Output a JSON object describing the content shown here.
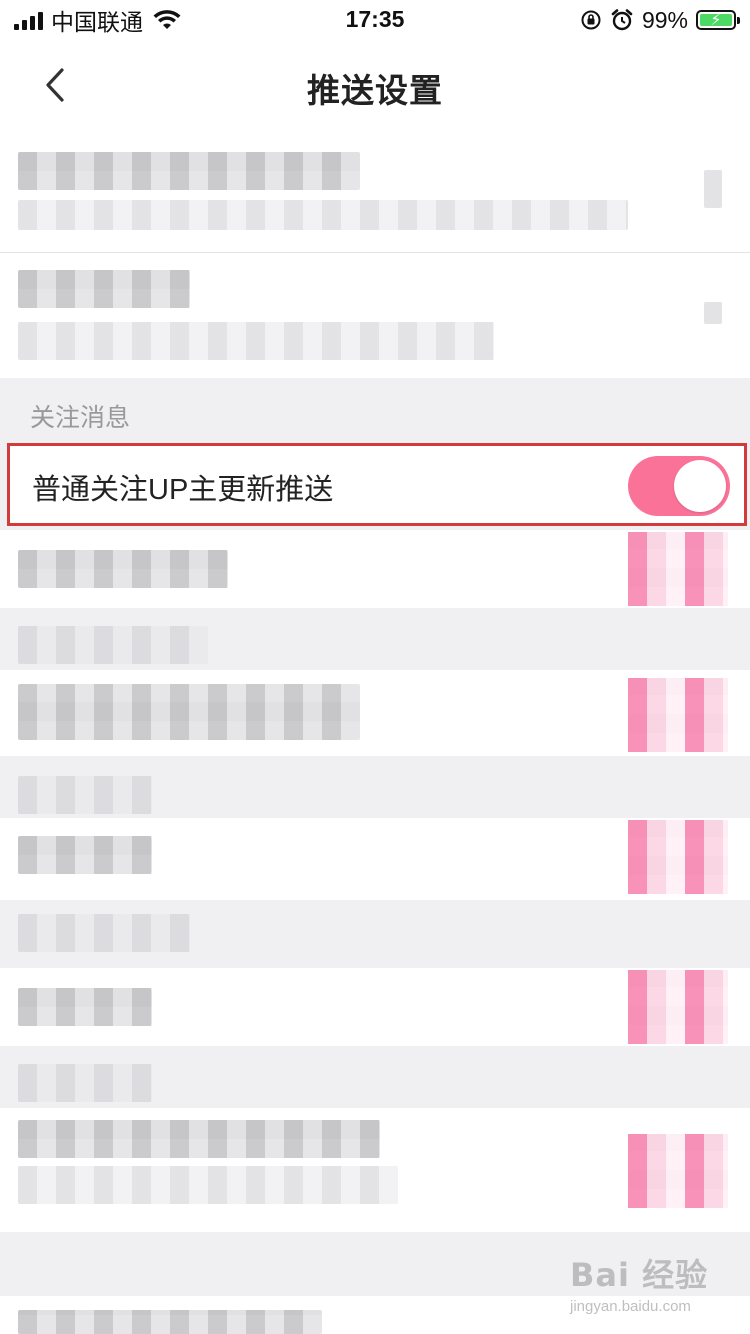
{
  "status_bar": {
    "carrier": "中国联通",
    "time": "17:35",
    "battery_percent": "99%",
    "battery_color": "#4cd964",
    "icons": [
      "signal-icon",
      "wifi-icon",
      "orientation-lock-icon",
      "alarm-icon",
      "battery-icon"
    ]
  },
  "nav": {
    "title": "推送设置",
    "back_icon": "chevron-left-icon"
  },
  "section": {
    "header": "关注消息"
  },
  "highlighted_setting": {
    "label": "普通关注UP主更新推送",
    "enabled": true,
    "toggle_color": "#fb7299",
    "highlight_border_color": "#d23b3b"
  },
  "watermark": {
    "brand": "Bai  经验",
    "url": "jingyan.baidu.com"
  }
}
